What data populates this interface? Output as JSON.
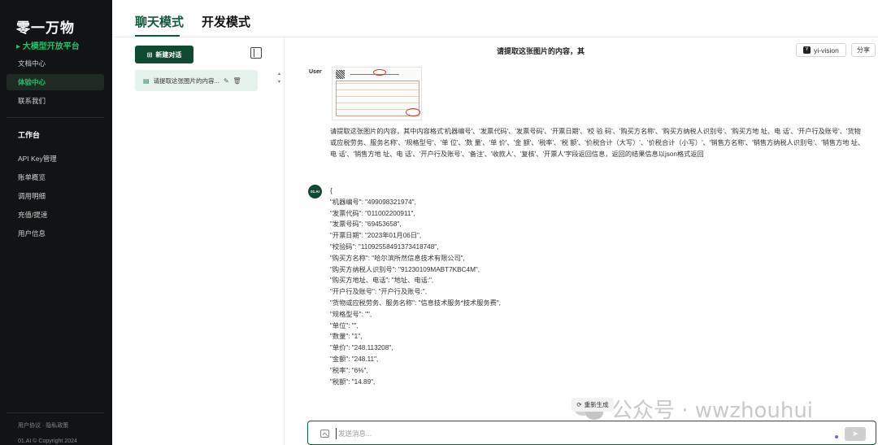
{
  "brand": {
    "title": "零一万物",
    "subtitle": "▸ 大模型开放平台"
  },
  "sidebar": {
    "items_top": [
      {
        "label": "文档中心",
        "active": false
      },
      {
        "label": "体验中心",
        "active": true
      },
      {
        "label": "联系我们",
        "active": false
      }
    ],
    "workspace_heading": "工作台",
    "items_workspace": [
      {
        "label": "API Key管理"
      },
      {
        "label": "账单概览"
      },
      {
        "label": "调用明细"
      },
      {
        "label": "充值/提速"
      },
      {
        "label": "用户信息"
      }
    ],
    "footer_links": "用户协议 · 隐私政策",
    "copyright": "01.AI © Copyright 2024"
  },
  "tabs": [
    {
      "label": "聊天模式",
      "active": true
    },
    {
      "label": "开发模式",
      "active": false
    }
  ],
  "conversations": {
    "new_label": "新建对话",
    "items": [
      {
        "title": "请提取这张图片的内容..."
      }
    ]
  },
  "chat": {
    "title": "请提取这张图片的内容，其",
    "model": "yi-vision",
    "share_label": "分享",
    "user_label": "User",
    "user_message": "请提取这张图片的内容，其中内容格式'机器编号'、'发票代码'、'发票号码'、'开票日期'、'校 验 码'、'购买方名称'、'购买方纳税人识别号'、'购买方地 址、电 话'、'开户行及账号'、'货物或应税劳务、服务名称'、'规格型号'、'单 位'、'数 量'、'单 价'、'金 额'、'税率'、'税 额'、'价税合计（大写）'、'价税合计（小写）'、'销售方名称'、'销售方纳税人识别号'、'销售方地 址、电 话'、'销售方地 址、电 话'、'开户行及账号'、'备注'、'收款人'、'复核'、'开票人'字段返回信息，返回的结果信息以json格式返回",
    "bot_avatar": "01.AI",
    "bot_response": "{\n\"机器编号\": \"499098321974\",\n\"发票代码\": \"011002200911\",\n\"发票号码\": \"69453658\",\n\"开票日期\": \"2023年01月06日\",\n\"校验码\": \"11092558491373418748\",\n\"购买方名称\": \"哈尔滨所然信息技术有限公司\",\n\"购买方纳税人识别号\": \"91230109MABT7KBC4M\",\n\"购买方地址、电话\": \"地址、电话:\",\n\"开户行及账号\": \"开户行及账号:\",\n\"货物或应税劳务、服务名称\": \"信息技术服务*技术服务费\",\n\"规格型号\": \"\",\n\"单位\": \"\",\n\"数量\": \"1\",\n\"单价\": \"248.113208\",\n\"金额\": \"248.11\",\n\"税率\": \"6%\",\n\"税额\": \"14.89\",",
    "regen_label": "重新生成",
    "input_placeholder": "发送消息..."
  },
  "watermark": {
    "text": "公众号 · wwzhouhui"
  }
}
